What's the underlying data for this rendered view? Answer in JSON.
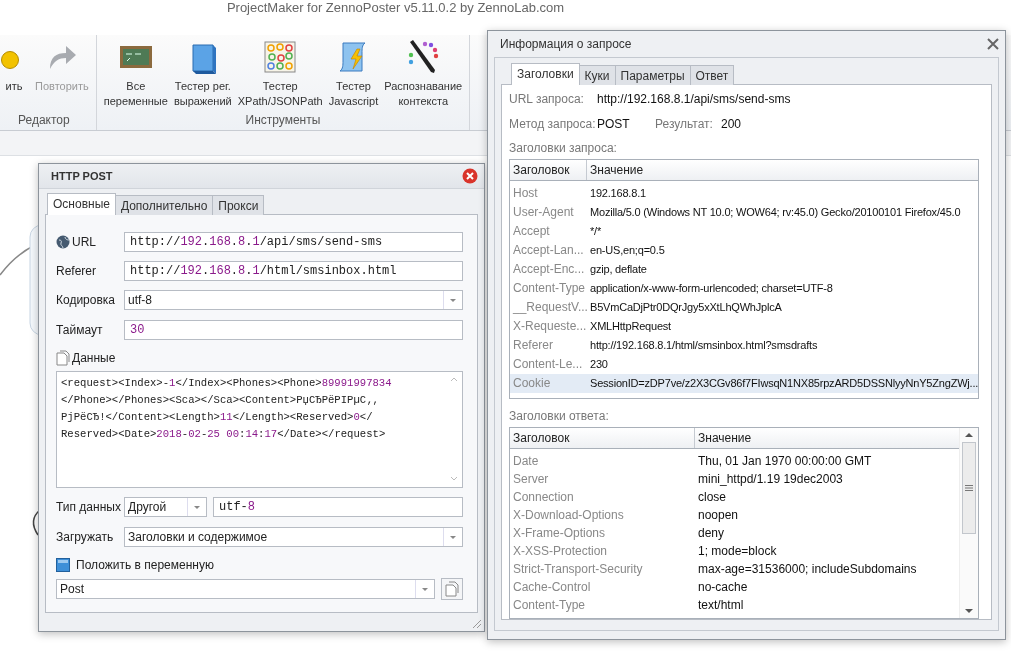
{
  "app_title": "ProjectMaker for ZennoPoster v5.11.0.2 by ZennoLab.com",
  "ribbon": [
    {
      "label": "Редактор",
      "buttons": [
        {
          "kind": "undo",
          "lines": [
            "ить"
          ],
          "disabled": false
        },
        {
          "kind": "redo",
          "lines": [
            "Повторить"
          ],
          "disabled": true
        }
      ]
    },
    {
      "label": "Инструменты",
      "buttons": [
        {
          "kind": "board",
          "lines": [
            "Все",
            "переменные"
          ],
          "disabled": false
        },
        {
          "kind": "cube",
          "lines": [
            "Тестер рег.",
            "выражений"
          ],
          "disabled": false
        },
        {
          "kind": "dots",
          "lines": [
            "Тестер",
            "XPath/JSONPath"
          ],
          "disabled": false
        },
        {
          "kind": "scroll",
          "lines": [
            "Тестер",
            "Javascript"
          ],
          "disabled": false
        },
        {
          "kind": "pencil",
          "lines": [
            "Распознавание",
            "контекста"
          ],
          "disabled": false
        }
      ]
    }
  ],
  "http_post": {
    "title": "HTTP POST",
    "tabs": [
      {
        "label": "Основные",
        "selected": true
      },
      {
        "label": "Дополнительно",
        "selected": false
      },
      {
        "label": "Прокси",
        "selected": false
      }
    ],
    "url": {
      "label": "URL",
      "value": "http://192.168.8.1/api/sms/send-sms"
    },
    "referer": {
      "label": "Referer",
      "value": "http://192.168.8.1/html/smsinbox.html"
    },
    "encoding": {
      "label": "Кодировка",
      "value": "utf-8"
    },
    "timeout": {
      "label": "Таймаут",
      "value": "30"
    },
    "data": {
      "label": "Данные",
      "lines": [
        "<request><Index>-1</Index><Phones><Phone>89991997834",
        "</Phone></Phones><Sca></Sca><Content>РџСЂРёРІРµС‚,",
        "РјРёСЂ!</Content><Length>11</Length><Reserved>0</",
        "Reserved><Date>2018-02-25 00:14:17</Date></request>"
      ]
    },
    "data_type": {
      "label": "Тип данных",
      "type": "Другой",
      "value": "utf-8"
    },
    "load": {
      "label": "Загружать",
      "value": "Заголовки и содержимое"
    },
    "save": {
      "label": "Положить в переменную"
    },
    "variable": {
      "value": "Post"
    }
  },
  "request_info": {
    "title": "Информация о запросе",
    "tabs": [
      {
        "label": "Заголовки",
        "selected": true
      },
      {
        "label": "Куки",
        "selected": false
      },
      {
        "label": "Параметры",
        "selected": false
      },
      {
        "label": "Ответ",
        "selected": false
      }
    ],
    "url": {
      "label": "URL запроса:",
      "value": "http://192.168.8.1/api/sms/send-sms"
    },
    "method": {
      "label": "Метод запроса:",
      "value": "POST"
    },
    "result": {
      "label": "Результат:",
      "value": "200"
    },
    "request_headers": {
      "title": "Заголовки запроса:",
      "columns": [
        "Заголовок",
        "Значение"
      ],
      "rows": [
        {
          "name": "Host",
          "value": "192.168.8.1",
          "selected": false
        },
        {
          "name": "User-Agent",
          "value": "Mozilla/5.0 (Windows NT 10.0; WOW64; rv:45.0) Gecko/20100101 Firefox/45.0",
          "selected": false
        },
        {
          "name": "Accept",
          "value": "*/*",
          "selected": false
        },
        {
          "name": "Accept-Lan...",
          "value": "en-US,en;q=0.5",
          "selected": false
        },
        {
          "name": "Accept-Enc...",
          "value": "gzip, deflate",
          "selected": false
        },
        {
          "name": "Content-Type",
          "value": "application/x-www-form-urlencoded; charset=UTF-8",
          "selected": false
        },
        {
          "name": "__RequestV...",
          "value": "B5VmCaDjPtr0DQrJgy5xXtLhQWhJplcA",
          "selected": false
        },
        {
          "name": "X-Requeste...",
          "value": "XMLHttpRequest",
          "selected": false
        },
        {
          "name": "Referer",
          "value": "http://192.168.8.1/html/smsinbox.html?smsdrafts",
          "selected": false
        },
        {
          "name": "Content-Le...",
          "value": "230",
          "selected": false
        },
        {
          "name": "Cookie",
          "value": "SessionID=zDP7ve/z2X3CGv86f7FIwsqN1NX85rpzARD5DSSNlyyNnY5ZngZWj...",
          "selected": true
        }
      ]
    },
    "response_headers": {
      "title": "Заголовки ответа:",
      "columns": [
        "Заголовок",
        "Значение"
      ],
      "rows": [
        {
          "name": "Date",
          "value": "Thu, 01 Jan 1970 00:00:00 GMT"
        },
        {
          "name": "Server",
          "value": "mini_httpd/1.19 19dec2003"
        },
        {
          "name": "Connection",
          "value": "close"
        },
        {
          "name": "X-Download-Options",
          "value": "noopen"
        },
        {
          "name": "X-Frame-Options",
          "value": "deny"
        },
        {
          "name": "X-XSS-Protection",
          "value": "1; mode=block"
        },
        {
          "name": "Strict-Transport-Security",
          "value": "max-age=31536000; includeSubdomains"
        },
        {
          "name": "Cache-Control",
          "value": "no-cache"
        },
        {
          "name": "Content-Type",
          "value": "text/html"
        }
      ]
    }
  }
}
